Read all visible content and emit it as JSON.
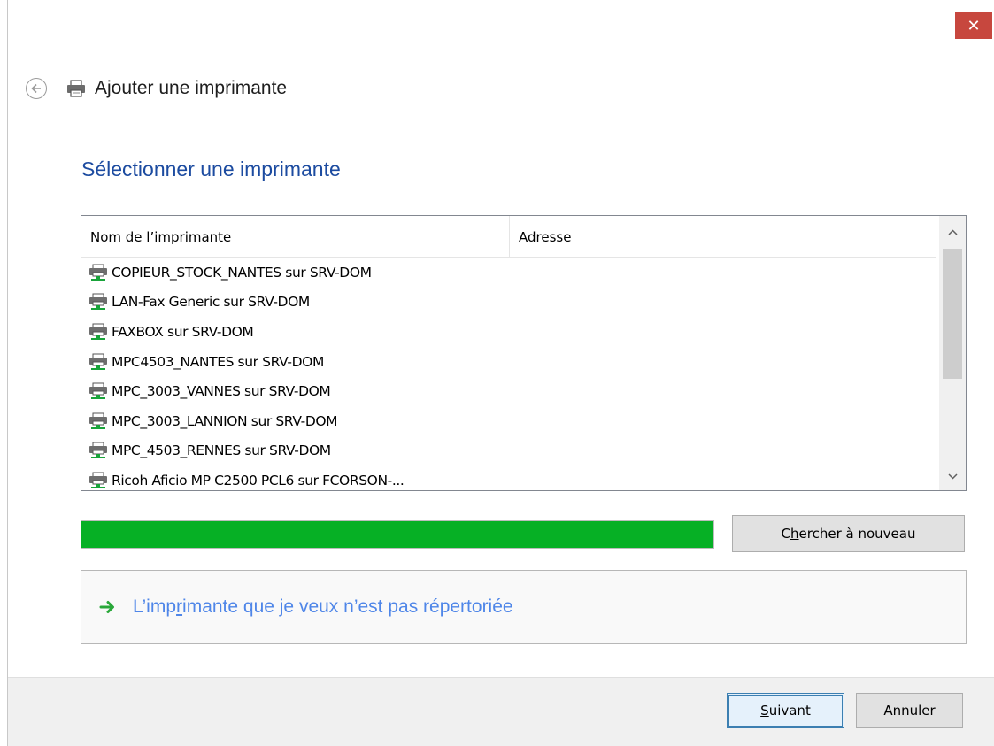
{
  "window": {
    "close_glyph": "✕",
    "close_color": "#c7473e"
  },
  "header": {
    "back_icon": "back-arrow-icon",
    "printer_icon": "printer-icon",
    "title": "Ajouter une imprimante"
  },
  "main": {
    "title": "Sélectionner une imprimante",
    "title_color": "#1c4ba0"
  },
  "printer_list": {
    "columns": [
      "Nom de l’imprimante",
      "Adresse"
    ],
    "rows": [
      {
        "name": "COPIEUR_STOCK_NANTES sur SRV-DOM",
        "address": ""
      },
      {
        "name": "LAN-Fax Generic sur SRV-DOM",
        "address": ""
      },
      {
        "name": "FAXBOX sur SRV-DOM",
        "address": ""
      },
      {
        "name": "MPC4503_NANTES sur SRV-DOM",
        "address": ""
      },
      {
        "name": "MPC_3003_VANNES sur SRV-DOM",
        "address": ""
      },
      {
        "name": "MPC_3003_LANNION sur SRV-DOM",
        "address": ""
      },
      {
        "name": "MPC_4503_RENNES sur SRV-DOM",
        "address": ""
      },
      {
        "name": "Ricoh Aficio MP C2500 PCL6 sur FCORSON-...",
        "address": ""
      }
    ],
    "row_icon": "network-printer-icon"
  },
  "search": {
    "progress_percent": 100,
    "progress_color": "#06b025",
    "search_again_prefix": "C",
    "search_again_accel": "h",
    "search_again_suffix": "ercher à nouveau"
  },
  "not_listed": {
    "icon": "green-arrow-icon",
    "prefix": "L’imp",
    "accel": "r",
    "suffix": "imante que je veux n’est pas répertoriée",
    "color": "#4f86e8"
  },
  "footer": {
    "next_accel": "S",
    "next_suffix": "uivant",
    "cancel_label": "Annuler"
  }
}
